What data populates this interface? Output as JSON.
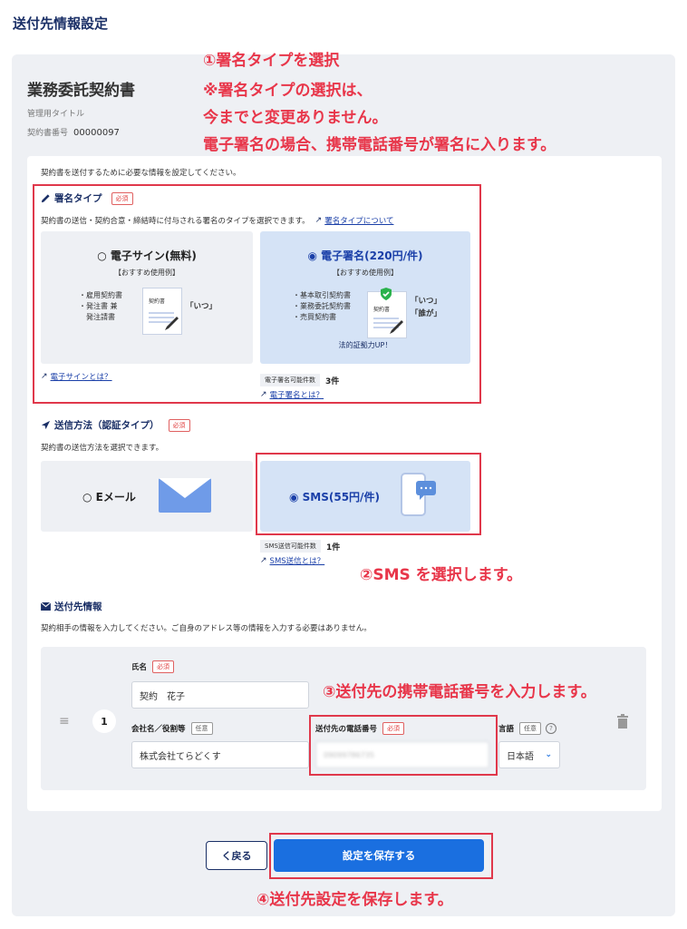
{
  "page_title": "送付先情報設定",
  "contract": {
    "title": "業務委託契約書",
    "admin_title_label": "管理用タイトル",
    "number_label": "契約書番号",
    "number_value": "00000097"
  },
  "intro": "契約書を送付するために必要な情報を設定してください。",
  "signature": {
    "heading": "署名タイプ",
    "required": "必須",
    "desc": "契約書の送信・契約合意・締結時に付与される署名のタイプを選択できます。",
    "about_link": "署名タイプについて",
    "options": [
      {
        "title": "○ 電子サイン(無料)",
        "sub": "【おすすめ使用例】",
        "items": [
          "・雇用契約書",
          "・発注書 兼",
          "　発注請書"
        ],
        "paper_label": "契約書",
        "quote1": "「いつ」",
        "link": "電子サインとは？",
        "selected": false
      },
      {
        "title": "◉ 電子署名(220円/件)",
        "sub": "【おすすめ使用例】",
        "items": [
          "・基本取引契約書",
          "・業務委託契約書",
          "・売買契約書"
        ],
        "paper_label": "契約書",
        "quote1": "「いつ」",
        "quote2": "「誰が」",
        "footer": "法的証拠力UP！",
        "stat_label": "電子署名可能件数",
        "stat_value": "3件",
        "link": "電子署名とは？",
        "selected": true
      }
    ]
  },
  "send_method": {
    "heading": "送信方法（認証タイプ）",
    "required": "必須",
    "desc": "契約書の送信方法を選択できます。",
    "options": [
      {
        "title": "○ Eメール",
        "selected": false
      },
      {
        "title": "◉ SMS(55円/件)",
        "selected": true,
        "stat_label": "SMS送信可能件数",
        "stat_value": "1件",
        "link": "SMS送信とは？"
      }
    ]
  },
  "recipient": {
    "heading": "送付先情報",
    "desc": "契約相手の情報を入力してください。ご自身のアドレス等の情報を入力する必要はありません。",
    "index": "1",
    "name_label": "氏名",
    "name_required": "必須",
    "name_value": "契約　花子",
    "company_label": "会社名／役割等",
    "company_optional": "任意",
    "company_value": "株式会社てらどくす",
    "phone_label": "送付先の電話番号",
    "phone_required": "必須",
    "phone_value": "09099786735",
    "lang_label": "言語",
    "lang_optional": "任意",
    "lang_value": "日本語"
  },
  "buttons": {
    "back": "く戻る",
    "save": "設定を保存する"
  },
  "annotations": {
    "a1_line1": "①署名タイプを選択",
    "a1_line2": "※署名タイプの選択は、",
    "a1_line3": "今までと変更ありません。",
    "a1_line4": "電子署名の場合、携帯電話番号が署名に入ります。",
    "a2": "②SMS を選択します。",
    "a3": "③送付先の携帯電話番号を入力します。",
    "a4": "④送付先設定を保存します。"
  },
  "colors": {
    "navy": "#1a2f66",
    "accent_blue": "#1a6fe0",
    "annotation_red": "#e8364a",
    "selected_card": "#d5e3f6",
    "panel_bg": "#eef0f4"
  },
  "icons": [
    "pencil-icon",
    "send-icon",
    "mail-icon",
    "external-link-icon",
    "drag-handle-icon",
    "trash-icon",
    "help-icon",
    "chevron-down-icon",
    "shield-check-icon",
    "pen-icon",
    "envelope-icon",
    "smartphone-icon"
  ]
}
